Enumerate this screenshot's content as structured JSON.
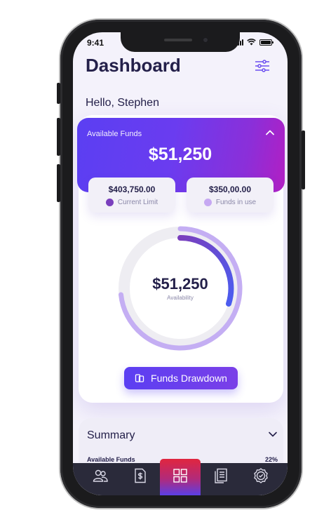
{
  "status_bar": {
    "time": "9:41"
  },
  "header": {
    "title": "Dashboard",
    "filter_icon": "sliders-icon"
  },
  "greeting": "Hello, Stephen",
  "funds": {
    "label": "Available Funds",
    "amount": "$51,250",
    "collapse_icon": "chevron-up-icon",
    "current_limit": {
      "value": "$403,750.00",
      "label": "Current Limit",
      "color": "#7a3fbd"
    },
    "funds_in_use": {
      "value": "$350,00.00",
      "label": "Funds in use",
      "color": "#c6a8f2"
    }
  },
  "availability": {
    "amount": "$51,250",
    "caption": "Availability",
    "colors": {
      "track": "#eeedf2",
      "outer": "#c4aef3",
      "gradient_start": "#7a3fbd",
      "gradient_end": "#4a5df0"
    }
  },
  "actions": {
    "drawdown_label": "Funds Drawdown",
    "drawdown_icon": "transfer-icon"
  },
  "summary": {
    "title": "Summary",
    "toggle_icon": "chevron-down-icon",
    "rows": [
      {
        "label": "Available Funds",
        "value": "22%"
      }
    ]
  },
  "tabbar": {
    "tabs": [
      {
        "icon": "users-icon",
        "active": false
      },
      {
        "icon": "dollar-document-icon",
        "active": false
      },
      {
        "icon": "dashboard-grid-icon",
        "active": true
      },
      {
        "icon": "documents-icon",
        "active": false
      },
      {
        "icon": "verified-badge-icon",
        "active": false
      }
    ]
  },
  "colors": {
    "accent": "#5b3ff2",
    "text_dark": "#24204a",
    "text_muted": "#8a87a8",
    "background": "#f4f2fb"
  }
}
